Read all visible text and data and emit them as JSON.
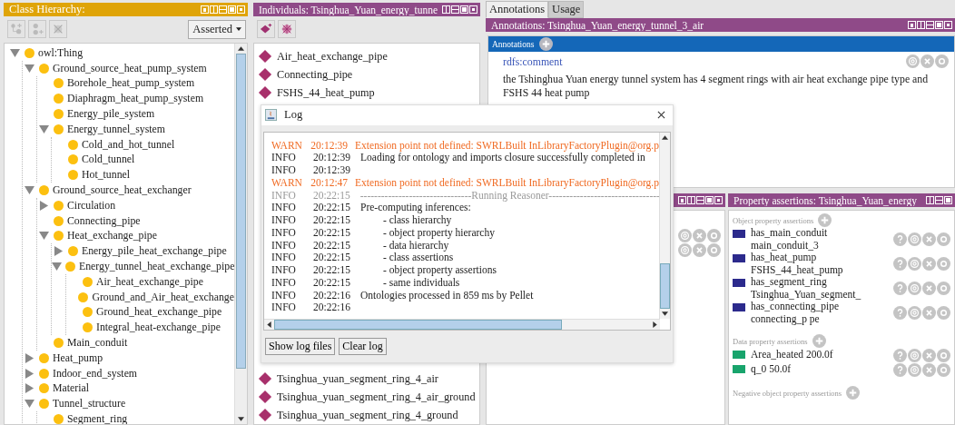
{
  "class_hierarchy": {
    "title": "Class Hierarchy:",
    "view_mode": "Asserted",
    "tree": [
      {
        "label": "owl:Thing",
        "expanded": true,
        "children": [
          {
            "label": "Ground_source_heat_pump_system",
            "expanded": true,
            "children": [
              {
                "label": "Borehole_heat_pump_system"
              },
              {
                "label": "Diaphragm_heat_pump_system"
              },
              {
                "label": "Energy_pile_system"
              },
              {
                "label": "Energy_tunnel_system",
                "expanded": true,
                "children": [
                  {
                    "label": "Cold_and_hot_tunnel"
                  },
                  {
                    "label": "Cold_tunnel"
                  },
                  {
                    "label": "Hot_tunnel"
                  }
                ]
              }
            ]
          },
          {
            "label": "Ground_source_heat_exchanger",
            "expanded": true,
            "children": [
              {
                "label": "Circulation",
                "expanded": false
              },
              {
                "label": "Connecting_pipe"
              },
              {
                "label": "Heat_exchange_pipe",
                "expanded": true,
                "children": [
                  {
                    "label": "Energy_pile_heat_exchange_pipe",
                    "expanded": false
                  },
                  {
                    "label": "Energy_tunnel_heat_exchange_pipe",
                    "expanded": true,
                    "children": [
                      {
                        "label": "Air_heat_exchange_pipe"
                      },
                      {
                        "label": "Ground_and_Air_heat_exchange"
                      },
                      {
                        "label": "Ground_heat_exchange_pipe"
                      },
                      {
                        "label": "Integral_heat-exchange_pipe"
                      }
                    ]
                  }
                ]
              },
              {
                "label": "Main_conduit"
              }
            ]
          },
          {
            "label": "Heat_pump",
            "expanded": false
          },
          {
            "label": "Indoor_end_system",
            "expanded": false
          },
          {
            "label": "Material",
            "expanded": false
          },
          {
            "label": "Tunnel_structure",
            "expanded": true,
            "children": [
              {
                "label": "Segment_ring"
              }
            ]
          }
        ]
      }
    ]
  },
  "individuals": {
    "title": "Individuals: Tsinghua_Yuan_energy_tunne",
    "items": [
      "Air_heat_exchange_pipe",
      "Connecting_pipe",
      "FSHS_44_heat_pump"
    ],
    "items_lower": [
      "Tsinghua_yuan_segment_ring_4_air",
      "Tsinghua_yuan_segment_ring_4_air_ground",
      "Tsinghua_yuan_segment_ring_4_ground"
    ]
  },
  "right_tabs": [
    {
      "label": "Annotations",
      "selected": true
    },
    {
      "label": "Usage",
      "selected": false
    }
  ],
  "annotations": {
    "title": "Annotations: Tsinghua_Yuan_energy_tunnel_3_air",
    "section": "Annotations",
    "entries": [
      {
        "property": "rdfs:comment",
        "value": "the Tshinghua Yuan energy tunnel system has 4 segment rings with air heat exchange pipe type and FSHS 44 heat pump"
      }
    ]
  },
  "property_assertions": {
    "title": "Property assertions: Tsinghua_Yuan_energy",
    "sections": [
      {
        "label": "Object property assertions",
        "kind": "object",
        "items": [
          {
            "property": "has_main_conduit",
            "value": "main_conduit_3"
          },
          {
            "property": "has_heat_pump",
            "value": "FSHS_44_heat_pump"
          },
          {
            "property": "has_segment_ring",
            "value": "Tsinghua_Yuan_segment_"
          },
          {
            "property": "has_connecting_pipe",
            "value": "connecting_p pe"
          }
        ]
      },
      {
        "label": "Data property assertions",
        "kind": "data",
        "items": [
          {
            "property": "Area_heated",
            "value": "200.0f"
          },
          {
            "property": "q_0",
            "value": "50.0f"
          }
        ]
      },
      {
        "label": "Negative object property assertions"
      }
    ]
  },
  "log": {
    "title": "Log",
    "entries": [
      {
        "kind": "warn",
        "severity": "WARN",
        "time": "20:12:39",
        "message": "Extension point not defined: SWRLBuilt InLibraryFactoryPlugin@org.p"
      },
      {
        "kind": "info",
        "severity": "INFO",
        "time": "20:12:39",
        "message": "Loading for ontology and imports closure successfully completed in"
      },
      {
        "kind": "info",
        "severity": "INFO",
        "time": "20:12:39"
      },
      {
        "kind": "warn",
        "severity": "WARN",
        "time": "20:12:47",
        "message": "Extension point not defined: SWRLBuilt InLibraryFactoryPlugin@org.p"
      },
      {
        "kind": "separator",
        "severity": "INFO",
        "time": "20:22:15",
        "message": "--------------------------------Running Reasoner--------------------------------"
      },
      {
        "kind": "info",
        "severity": "INFO",
        "time": "20:22:15",
        "message": "Pre-computing inferences:"
      },
      {
        "kind": "step",
        "severity": "INFO",
        "time": "20:22:15",
        "message": "-  class hierarchy"
      },
      {
        "kind": "step",
        "severity": "INFO",
        "time": "20:22:15",
        "message": "-  object property hierarchy"
      },
      {
        "kind": "step",
        "severity": "INFO",
        "time": "20:22:15",
        "message": "-  data hierarchy"
      },
      {
        "kind": "step",
        "severity": "INFO",
        "time": "20:22:15",
        "message": "-  class assertions"
      },
      {
        "kind": "step",
        "severity": "INFO",
        "time": "20:22:15",
        "message": "-  object property assertions"
      },
      {
        "kind": "step",
        "severity": "INFO",
        "time": "20:22:15",
        "message": "-  same individuals"
      },
      {
        "kind": "info",
        "severity": "INFO",
        "time": "20:22:16",
        "message": "Ontologies processed in 859 ms by Pellet"
      },
      {
        "kind": "info",
        "severity": "INFO",
        "time": "20:22:16"
      }
    ],
    "buttons": [
      "Show log files",
      "Clear log"
    ]
  }
}
